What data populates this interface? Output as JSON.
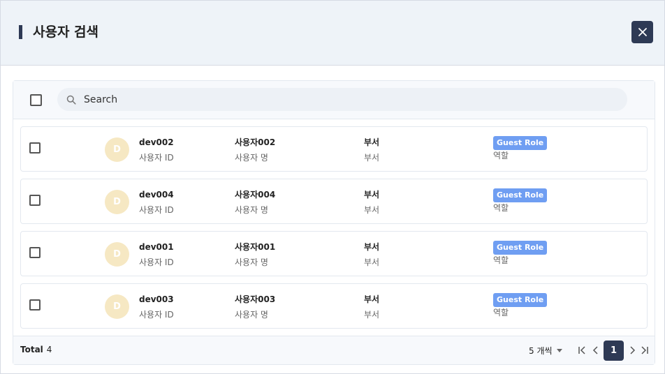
{
  "dialog": {
    "title": "사용자 검색",
    "close_icon": "close-icon"
  },
  "search": {
    "placeholder": "Search",
    "value": ""
  },
  "rows": [
    {
      "avatar": "D",
      "id": "dev002",
      "id_label": "사용자 ID",
      "name": "사용자002",
      "name_label": "사용자 명",
      "dept": "부서",
      "dept_label": "부서",
      "role": "Guest Role",
      "role_label": "역할"
    },
    {
      "avatar": "D",
      "id": "dev004",
      "id_label": "사용자 ID",
      "name": "사용자004",
      "name_label": "사용자 명",
      "dept": "부서",
      "dept_label": "부서",
      "role": "Guest Role",
      "role_label": "역할"
    },
    {
      "avatar": "D",
      "id": "dev001",
      "id_label": "사용자 ID",
      "name": "사용자001",
      "name_label": "사용자 명",
      "dept": "부서",
      "dept_label": "부서",
      "role": "Guest Role",
      "role_label": "역할"
    },
    {
      "avatar": "D",
      "id": "dev003",
      "id_label": "사용자 ID",
      "name": "사용자003",
      "name_label": "사용자 명",
      "dept": "부서",
      "dept_label": "부서",
      "role": "Guest Role",
      "role_label": "역할"
    }
  ],
  "footer": {
    "total_label": "Total",
    "total_count": "4",
    "per_page": "5 개씩",
    "current_page": "1"
  },
  "colors": {
    "header_bg": "#eef3f8",
    "accent": "#2e3a55",
    "badge": "#6f9ef2",
    "avatar_bg": "#f6e8c3"
  }
}
